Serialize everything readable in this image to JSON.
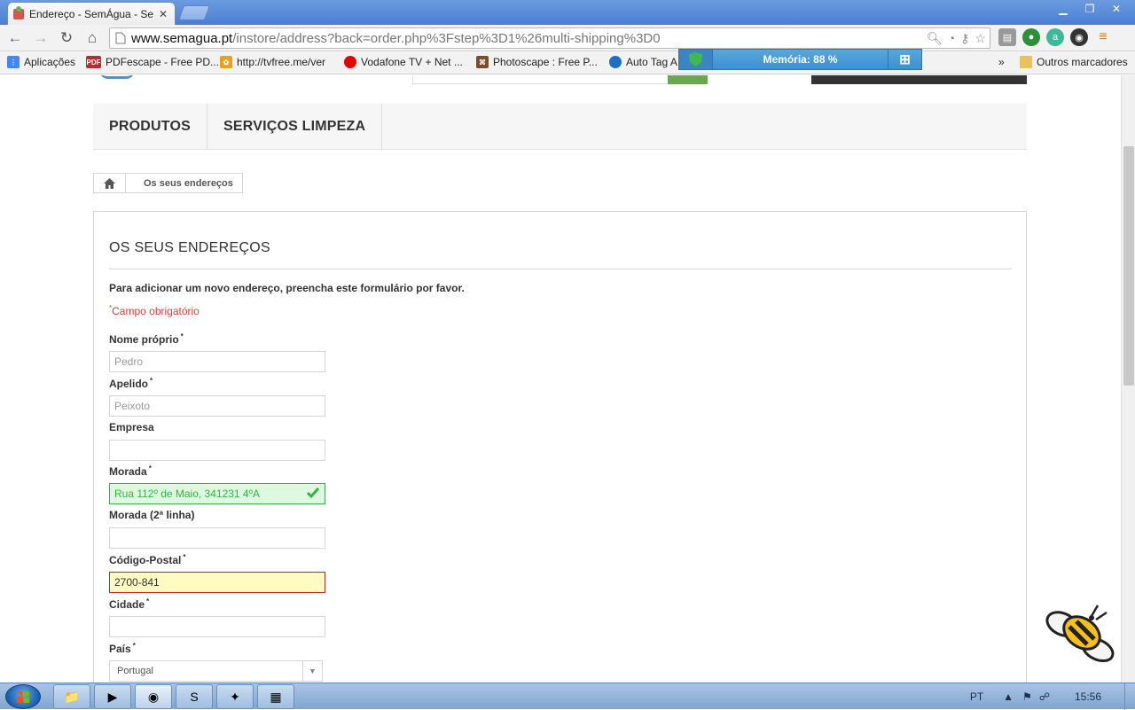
{
  "browser": {
    "tab_title": "Endereço - SemÁgua - Se",
    "url_host": "www.semagua.pt",
    "url_path": "/instore/address?back=order.php%3Fstep%3D1%26multi-shipping%3D0",
    "bookmarks": [
      {
        "label": "Aplicações",
        "icon": "apps-grid-icon",
        "color": "#4285f4"
      },
      {
        "label": "PDFescape - Free PD...",
        "icon": "pdf-icon",
        "color": "#c0282d"
      },
      {
        "label": "http://tvfree.me/ver",
        "icon": "tvfree-icon",
        "color": "#e8a21a"
      },
      {
        "label": "Vodafone TV + Net ...",
        "icon": "vodafone-icon",
        "color": "#e60000"
      },
      {
        "label": "Photoscape : Free P...",
        "icon": "photoscape-icon",
        "color": "#7a4c2a"
      },
      {
        "label": "Auto Tag A",
        "icon": "autotag-icon",
        "color": "#1f6fc0"
      }
    ],
    "bookmarks_overflow": "»",
    "other_bookmarks": "Outros marcadores",
    "memory_label": "Memória: 88 %"
  },
  "site": {
    "nav": [
      "PRODUTOS",
      "SERVIÇOS LIMPEZA"
    ],
    "breadcrumb": "Os seus endereços"
  },
  "form": {
    "heading": "OS SEUS ENDEREÇOS",
    "intro": "Para adicionar um novo endereço, preencha este formulário por favor.",
    "required_note": "Campo obrigatório",
    "required_mark": "*",
    "fields": [
      {
        "label": "Nome próprio",
        "required": true,
        "value": "Pedro",
        "state": "placeholder"
      },
      {
        "label": "Apelido",
        "required": true,
        "value": "Peixoto",
        "state": "placeholder"
      },
      {
        "label": "Empresa",
        "required": false,
        "value": "",
        "state": "empty"
      },
      {
        "label": "Morada",
        "required": true,
        "value": "Rua 112º de Maio, 341231 4ºA",
        "state": "valid"
      },
      {
        "label": "Morada (2ª linha)",
        "required": false,
        "value": "",
        "state": "empty"
      },
      {
        "label": "Código-Postal",
        "required": true,
        "value": "2700-841",
        "state": "error"
      },
      {
        "label": "Cidade",
        "required": true,
        "value": "",
        "state": "empty"
      },
      {
        "label": "País",
        "required": true,
        "value": "Portugal",
        "state": "select"
      }
    ]
  },
  "taskbar": {
    "lang": "PT",
    "clock": "15:56"
  },
  "colors": {
    "accent_green": "#6aa84f",
    "error_red": "#e03c31",
    "valid_green": "#35b33f"
  }
}
